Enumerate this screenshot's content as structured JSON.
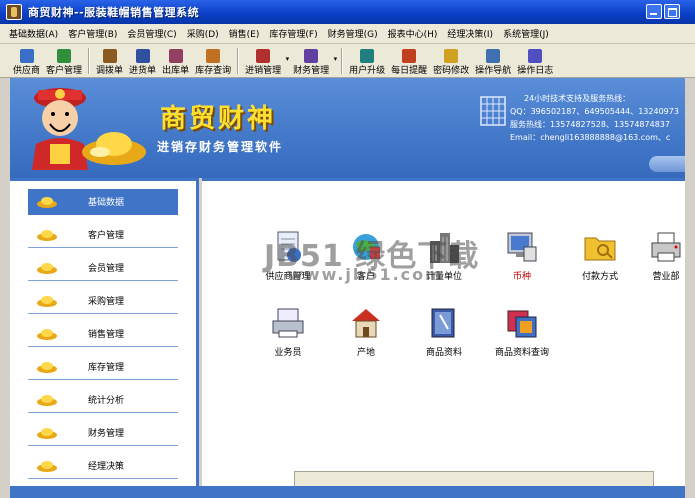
{
  "window": {
    "title": "商贸财神--服装鞋帽销售管理系统"
  },
  "menu": [
    "基础数据(A)",
    "客户管理(B)",
    "会员管理(C)",
    "采购(D)",
    "销售(E)",
    "库存管理(F)",
    "财务管理(G)",
    "报表中心(H)",
    "经理决策(I)",
    "系统管理(J)"
  ],
  "toolbar": [
    {
      "label": "供应商",
      "icon": "supplier-icon",
      "color": "#3a6fc8"
    },
    {
      "label": "客户管理",
      "icon": "customer-icon",
      "color": "#2f8f3a"
    },
    {
      "label": "调拨单",
      "icon": "transfer-icon",
      "color": "#8a5a20"
    },
    {
      "label": "进货单",
      "icon": "purchase-icon",
      "color": "#3050a0"
    },
    {
      "label": "出库单",
      "icon": "outbound-icon",
      "color": "#904060"
    },
    {
      "label": "库存查询",
      "icon": "stock-query-icon",
      "color": "#c07020"
    },
    {
      "label": "进销管理",
      "icon": "trade-icon",
      "color": "#b03030"
    },
    {
      "label": "财务管理",
      "icon": "finance-icon",
      "color": "#6040a0"
    },
    {
      "label": "用户升级",
      "icon": "upgrade-icon",
      "color": "#208080"
    },
    {
      "label": "每日提醒",
      "icon": "reminder-icon",
      "color": "#c04020"
    },
    {
      "label": "密码修改",
      "icon": "password-icon",
      "color": "#d0a020"
    },
    {
      "label": "操作导航",
      "icon": "navigation-icon",
      "color": "#4070b0"
    },
    {
      "label": "操作日志",
      "icon": "log-icon",
      "color": "#5050c0"
    }
  ],
  "banner": {
    "title": "商贸财神",
    "subtitle": "进销存财务管理软件",
    "support_line1": "24小时技术支持及服务热线：",
    "support_line2": "QQ：396502187、649505444、13240973",
    "support_line3": "服务热线：13574827528、13574874837",
    "support_line4": "Email：chengli163888888@163.com、c"
  },
  "sidebar": [
    {
      "label": "基础数据",
      "active": true
    },
    {
      "label": "客户管理"
    },
    {
      "label": "会员管理"
    },
    {
      "label": "采购管理"
    },
    {
      "label": "销售管理"
    },
    {
      "label": "库存管理"
    },
    {
      "label": "统计分析"
    },
    {
      "label": "财务管理"
    },
    {
      "label": "经理决策"
    }
  ],
  "grid": [
    {
      "label": "供应商管理",
      "icon": "supplier-doc-icon"
    },
    {
      "label": "客户",
      "icon": "customer-globe-icon"
    },
    {
      "label": "计量单位",
      "icon": "building-icon"
    },
    {
      "label": "币种",
      "icon": "currency-monitor-icon",
      "highlight": true
    },
    {
      "label": "付款方式",
      "icon": "payment-folder-icon"
    },
    {
      "label": "营业部",
      "icon": "branch-printer-icon"
    },
    {
      "label": "业务员",
      "icon": "salesman-printer-icon"
    },
    {
      "label": "产地",
      "icon": "origin-house-icon"
    },
    {
      "label": "商品资料",
      "icon": "product-book-icon"
    },
    {
      "label": "商品资料查询",
      "icon": "product-query-icon"
    }
  ],
  "watermark": {
    "text": "JB51 绿色下载",
    "url": "www.jb51.com"
  }
}
